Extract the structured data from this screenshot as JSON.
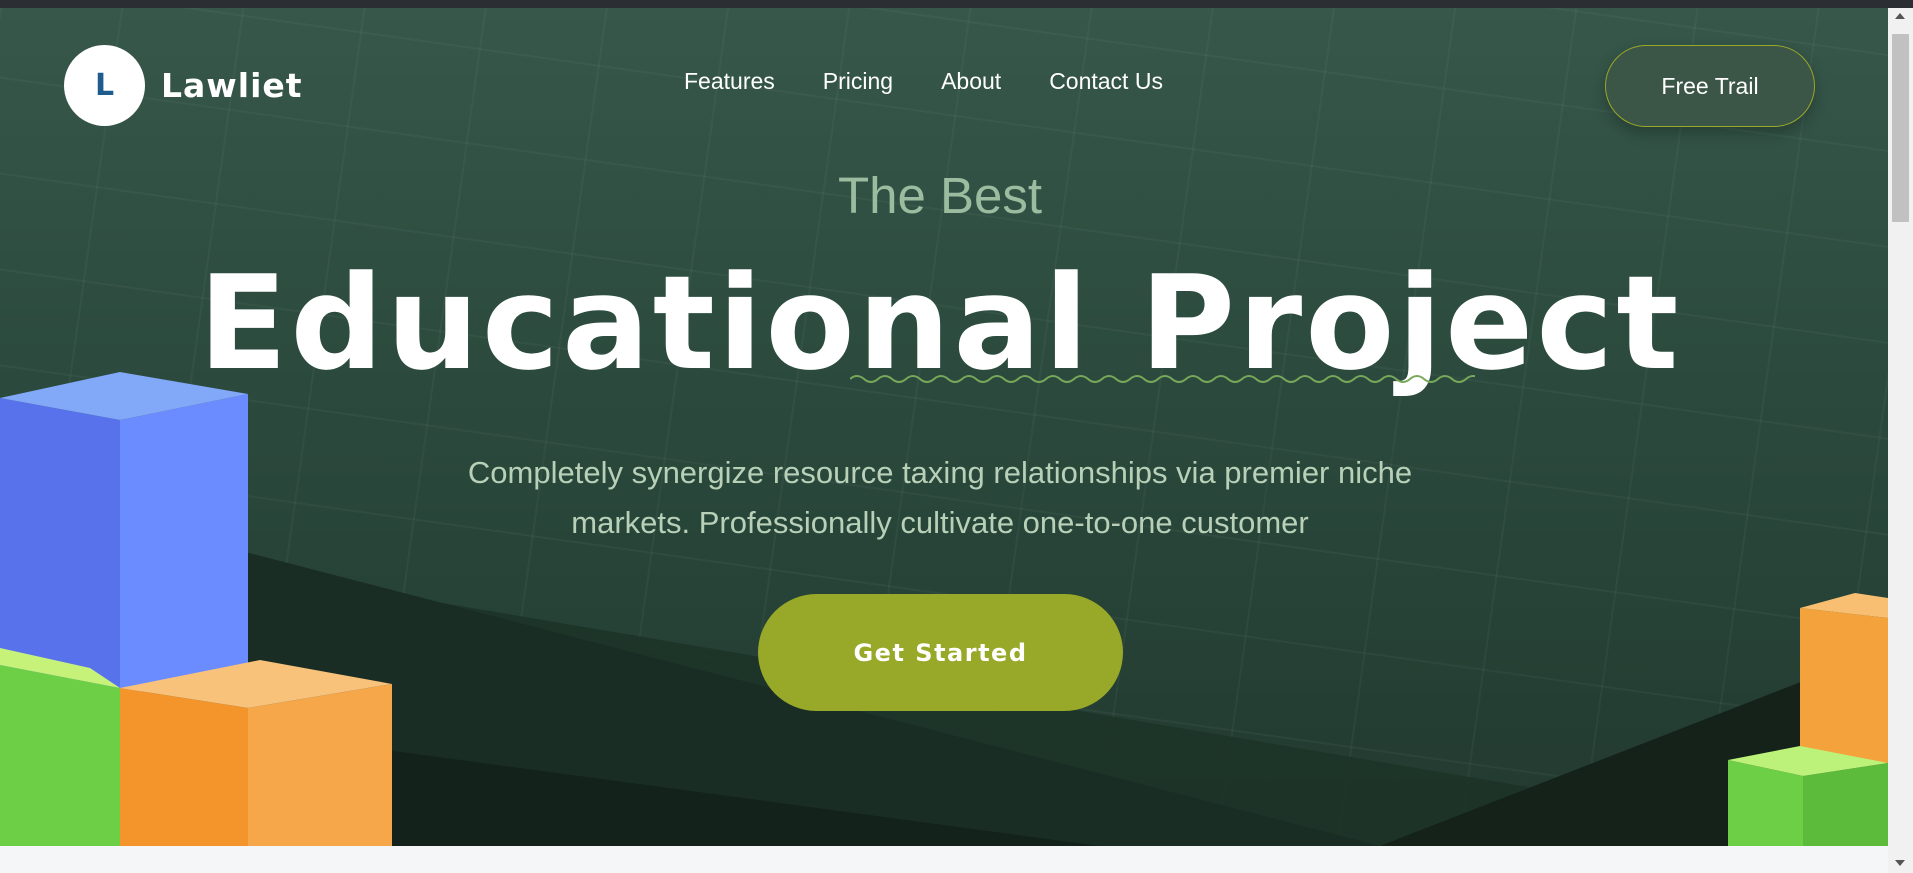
{
  "brand": {
    "initial": "L",
    "name": "Lawliet"
  },
  "nav": {
    "items": [
      {
        "label": "Features"
      },
      {
        "label": "Pricing"
      },
      {
        "label": "About"
      },
      {
        "label": "Contact Us"
      }
    ]
  },
  "header": {
    "trial_label": "Free Trail"
  },
  "hero": {
    "eyebrow": "The Best",
    "headline": "Educational Project",
    "description": "Completely synergize resource taxing relationships via premier niche markets. Professionally cultivate one-to-one customer",
    "cta_label": "Get Started"
  },
  "colors": {
    "hero_bg": "#2b4a3d",
    "accent": "#98a828",
    "eyebrow": "#9cbc9f",
    "cube_blue": "#6b8cff",
    "cube_orange": "#f39a2e",
    "cube_green": "#6ccf45"
  },
  "icons": {
    "logo": "logo-circle-icon",
    "scroll_up": "scroll-up-arrow-icon",
    "scroll_down": "scroll-down-arrow-icon"
  }
}
